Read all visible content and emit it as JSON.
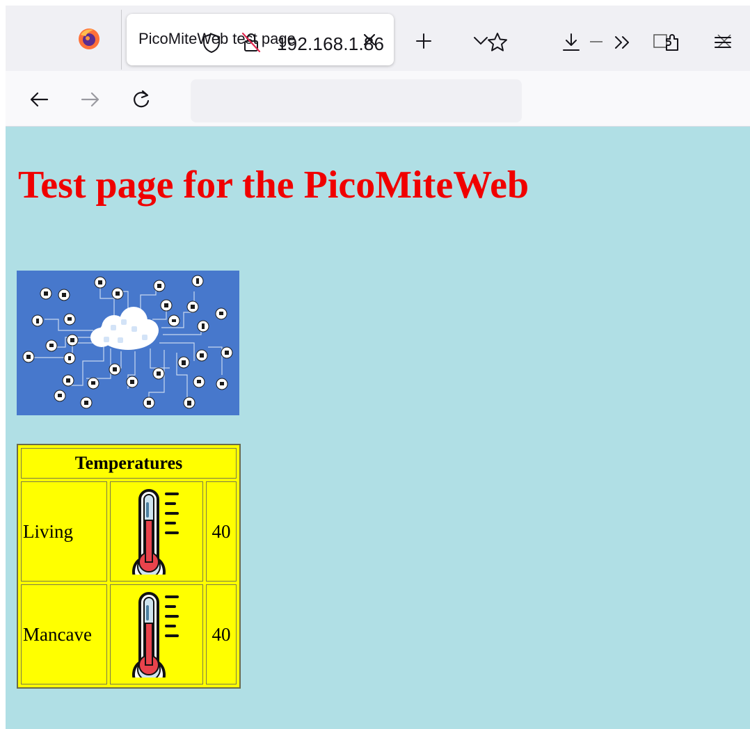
{
  "browser": {
    "tab_title": "PicoMiteWeb test page",
    "url": "192.168.1.86",
    "icons": [
      "firefox-logo",
      "close-tab",
      "new-tab",
      "tab-list",
      "minimize",
      "maximize",
      "close-window",
      "back",
      "forward",
      "reload",
      "shield",
      "insecure-lock",
      "bookmark-star",
      "download",
      "overflow",
      "extensions",
      "menu"
    ]
  },
  "page": {
    "background_color": "#b0dfe5",
    "heading": "Test page for the PicoMiteWeb",
    "heading_color": "#f00000",
    "image_subject": "iot-cloud-network",
    "table": {
      "header": "Temperatures",
      "background_color": "#ffff00",
      "rows": [
        {
          "room": "Living",
          "value": "40"
        },
        {
          "room": "Mancave",
          "value": "40"
        }
      ]
    }
  }
}
